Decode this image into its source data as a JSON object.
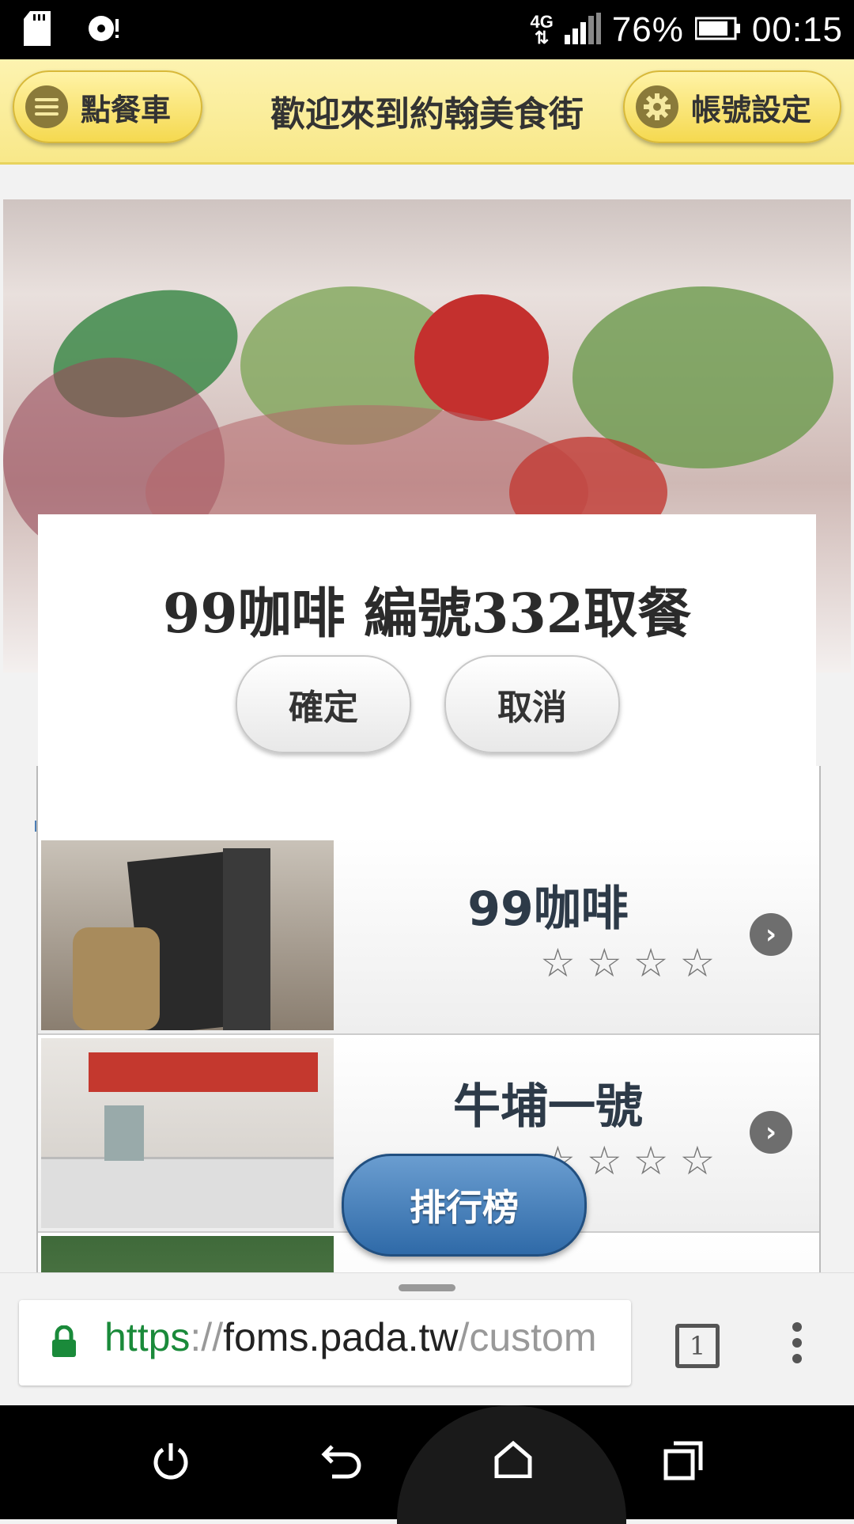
{
  "status_bar": {
    "network": "4G",
    "battery": "76%",
    "time": "00:15"
  },
  "header": {
    "cart_label": "點餐車",
    "title": "歡迎來到約翰美食街",
    "account_label": "帳號設定"
  },
  "dialog": {
    "message": "99咖啡 編號332取餐",
    "confirm_label": "確定",
    "cancel_label": "取消"
  },
  "restaurants": [
    {
      "name": "99咖啡",
      "stars": "☆☆☆☆"
    },
    {
      "name": "牛埔一號",
      "stars": "☆☆☆☆"
    },
    {
      "name": ""
    }
  ],
  "ranking_label": "排行榜",
  "browser": {
    "url_scheme": "https",
    "url_sep": "://",
    "url_host": "foms.pada.tw",
    "url_path": "/custom",
    "tab_count": "1"
  },
  "colors": {
    "header_bg": "#f8e889",
    "list_accent": "#4a7db5",
    "ranking_button": "#2f6aa8"
  }
}
